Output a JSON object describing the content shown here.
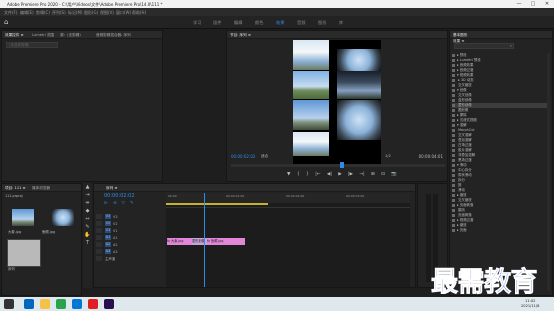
{
  "window": {
    "title": "Adobe Premiere Pro 2020 - C:\\用户\\Videos\\文件\\Adobe Premiere Pro\\14.0\\111 *",
    "minimize": "—",
    "maximize": "□",
    "close": "✕"
  },
  "menu": [
    "文件(F)",
    "编辑(E)",
    "剪辑(C)",
    "序列(S)",
    "标记(M)",
    "图形(G)",
    "视图(V)",
    "窗口(W)",
    "帮助(H)"
  ],
  "workspaces": {
    "items": [
      "学习",
      "组件",
      "编辑",
      "颜色",
      "效果",
      "音频",
      "图形",
      "库"
    ],
    "active_index": 4
  },
  "source_panel": {
    "tabs": [
      "效果控件 ≡",
      "Lumetri 范围",
      "源：(无剪辑)",
      "音频剪辑混合器: 序列"
    ],
    "search_placeholder": "(未选择剪辑)"
  },
  "program_monitor": {
    "tab": "节目: 序列 ≡",
    "timecode": "00:00:02:02",
    "fit": "适合",
    "ratio": "1/2",
    "duration": "00:00:04:01",
    "controls": [
      "▼",
      "{",
      "}",
      "|←",
      "◀|",
      "▶",
      "|▶",
      "→|",
      "⊞",
      "⊡",
      "📷"
    ]
  },
  "effects_panel": {
    "title": "基本图形",
    "tab": "效果 ≡",
    "items": [
      {
        "label": "▸ 预设",
        "sel": false
      },
      {
        "label": "▸ Lumetri 预设",
        "sel": false
      },
      {
        "label": "▸ 音频效果",
        "sel": false
      },
      {
        "label": "▸ 音频过渡",
        "sel": false
      },
      {
        "label": "▾ 视频效果",
        "sel": false
      },
      {
        "label": "  ▸ 3D 动态",
        "sel": false
      },
      {
        "label": "    交叉缩放",
        "sel": false
      },
      {
        "label": "▾ 划像",
        "sel": false
      },
      {
        "label": "    交叉划像",
        "sel": false
      },
      {
        "label": "    盒形划像",
        "sel": false
      },
      {
        "label": "    菱形划像",
        "sel": true
      },
      {
        "label": "    圆划像",
        "sel": false
      },
      {
        "label": "▸ 擦除",
        "sel": false
      },
      {
        "label": "▸ 沉浸式视频",
        "sel": false
      },
      {
        "label": "▾ 溶解",
        "sel": false
      },
      {
        "label": "    MorphCut",
        "sel": false
      },
      {
        "label": "    交叉溶解",
        "sel": false
      },
      {
        "label": "    叠加溶解",
        "sel": false
      },
      {
        "label": "    白场过渡",
        "sel": false
      },
      {
        "label": "    胶片溶解",
        "sel": false
      },
      {
        "label": "    非叠加溶解",
        "sel": false
      },
      {
        "label": "    黑场过渡",
        "sel": false
      },
      {
        "label": "▾ 滑动",
        "sel": false
      },
      {
        "label": "    中心拆分",
        "sel": false
      },
      {
        "label": "    带状滑动",
        "sel": false
      },
      {
        "label": "    拆分",
        "sel": false
      },
      {
        "label": "    推",
        "sel": false
      },
      {
        "label": "    滑动",
        "sel": false
      },
      {
        "label": "▸ 缩放",
        "sel": false
      },
      {
        "label": "    交叉缩放",
        "sel": false
      },
      {
        "label": "▸ 页面剥落",
        "sel": false
      },
      {
        "label": "    翻页",
        "sel": false
      },
      {
        "label": "    页面剥落",
        "sel": false
      },
      {
        "label": "▸ 视频过渡",
        "sel": false
      },
      {
        "label": "▸ 缩放",
        "sel": false
      },
      {
        "label": "▸ 页面",
        "sel": false
      }
    ]
  },
  "project_panel": {
    "tabs": [
      "项目: 111 ≡",
      "媒体浏览器"
    ],
    "name": "111.prproj",
    "items": [
      {
        "label": "大象.jpg"
      },
      {
        "label": "鱼眼.jpg"
      },
      {
        "label": "序列"
      }
    ]
  },
  "timeline": {
    "tab": "序列 ≡",
    "timecode": "00:00:02:02",
    "tracks": [
      "V3",
      "V2",
      "V1",
      "A1",
      "A2",
      "A3",
      "主声道"
    ],
    "ruler": [
      "00:00",
      "00:00:01:00",
      "00:00:02:00",
      "00:00:03:00",
      "00:00:04:00"
    ],
    "clips": [
      {
        "label": "fx 大象.jpg"
      },
      {
        "label": "菱形划像"
      },
      {
        "label": "fx 鱼眼.jpg"
      }
    ]
  },
  "taskbar": {
    "time": "11:02",
    "date": "2021/11/8"
  },
  "watermark": "最需教育"
}
